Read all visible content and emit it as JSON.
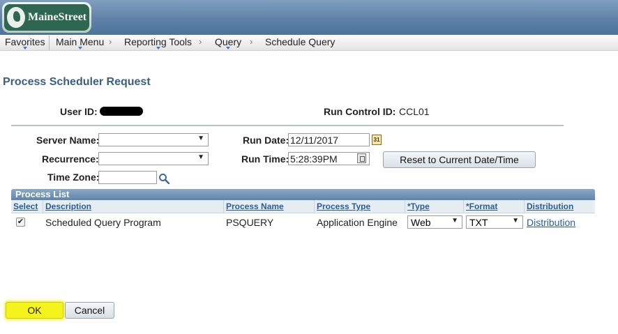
{
  "header": {
    "logo_text": "MaineStreet"
  },
  "nav": {
    "favorites": "Favorites",
    "main_menu": "Main Menu",
    "reporting_tools": "Reporting Tools",
    "query": "Query",
    "schedule_query": "Schedule Query",
    "chevron": "›"
  },
  "page": {
    "title": "Process Scheduler Request"
  },
  "request": {
    "user_id_label": "User ID:",
    "run_control_label": "Run Control ID:",
    "run_control_value": "CCL01",
    "server_name_label": "Server Name:",
    "server_name_value": "",
    "recurrence_label": "Recurrence:",
    "recurrence_value": "",
    "time_zone_label": "Time Zone:",
    "time_zone_value": "",
    "run_date_label": "Run Date:",
    "run_date_value": "12/11/2017",
    "run_time_label": "Run Time:",
    "run_time_value": "5:28:39PM",
    "reset_button": "Reset to Current Date/Time",
    "calendar_icon_text": "31"
  },
  "process_list": {
    "title": "Process List",
    "columns": [
      "Select",
      "Description",
      "Process Name",
      "Process Type",
      "*Type",
      "*Format",
      "Distribution"
    ],
    "rows": [
      {
        "selected": "✔",
        "description": "Scheduled Query Program",
        "process_name": "PSQUERY",
        "process_type": "Application Engine",
        "type": "Web",
        "format": "TXT",
        "distribution": "Distribution"
      }
    ]
  },
  "buttons": {
    "ok": "OK",
    "cancel": "Cancel"
  },
  "colors": {
    "title": "#3a5f86",
    "link": "#2a5d94",
    "ok_highlight": "#f4f31c",
    "banner": "#5e82a7"
  }
}
